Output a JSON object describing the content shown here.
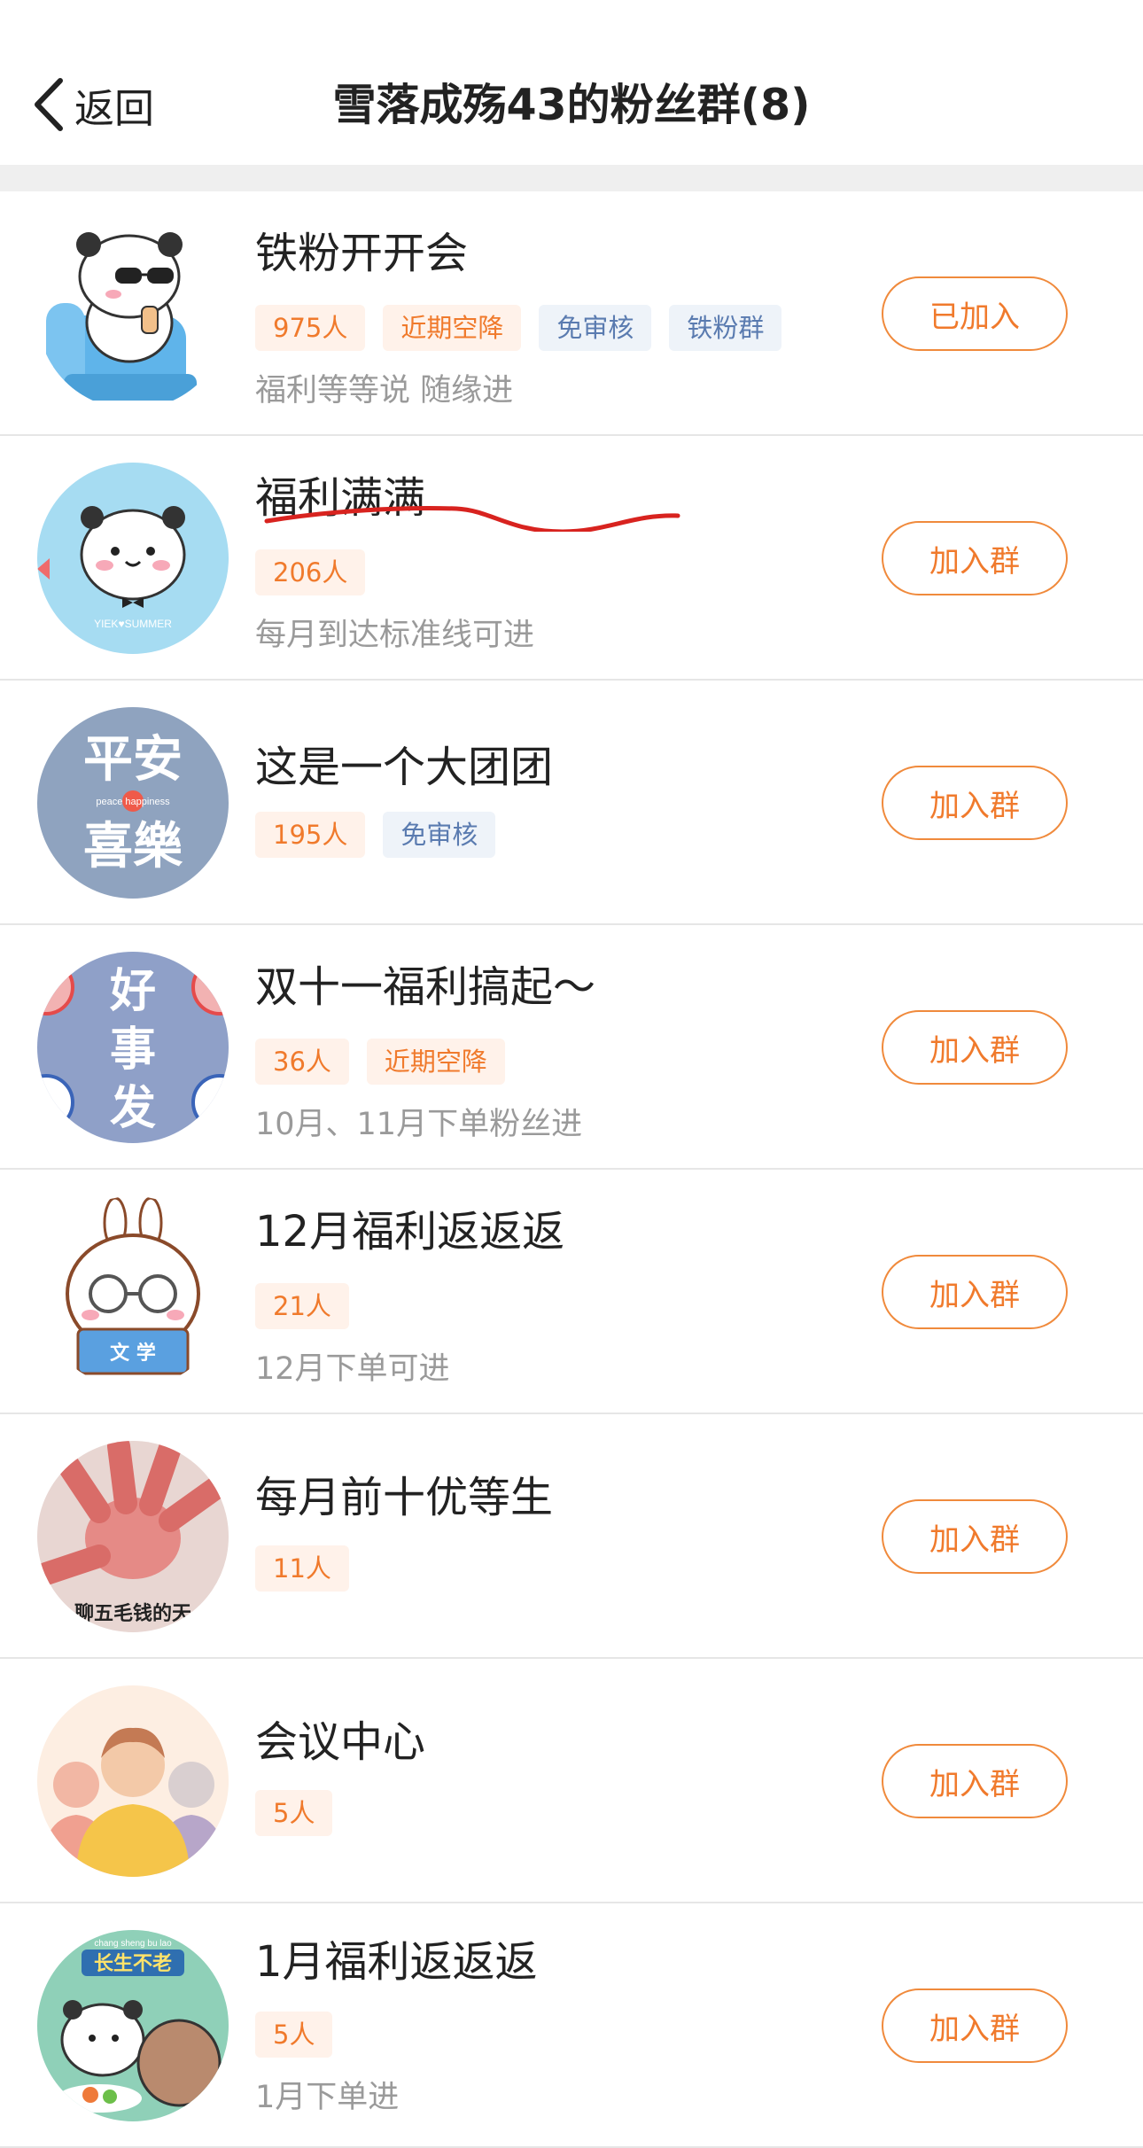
{
  "nav": {
    "back_label": "返回",
    "title": "雪落成殇43的粉丝群(8)"
  },
  "groups": [
    {
      "name": "铁粉开开会",
      "tags": [
        "975人",
        "近期空降",
        "免审核",
        "铁粉群"
      ],
      "desc": "福利等等说 随缘进",
      "button": "已加入"
    },
    {
      "name": "福利满满",
      "tags": [
        "206人"
      ],
      "desc": "每月到达标准线可进",
      "button": "加入群"
    },
    {
      "name": "这是一个大团团",
      "tags": [
        "195人",
        "免审核"
      ],
      "desc": "",
      "button": "加入群"
    },
    {
      "name": "双十一福利搞起～",
      "tags": [
        "36人",
        "近期空降"
      ],
      "desc": "10月、11月下单粉丝进",
      "button": "加入群"
    },
    {
      "name": "12月福利返返返",
      "tags": [
        "21人"
      ],
      "desc": "12月下单可进",
      "button": "加入群"
    },
    {
      "name": "每月前十优等生",
      "tags": [
        "11人"
      ],
      "desc": "",
      "button": "加入群"
    },
    {
      "name": "会议中心",
      "tags": [
        "5人"
      ],
      "desc": "",
      "button": "加入群"
    },
    {
      "name": "1月福利返返返",
      "tags": [
        "5人"
      ],
      "desc": "1月下单进",
      "button": "加入群"
    }
  ],
  "avatar_text": {
    "a2": "YIEK♥SUMMER",
    "a3_line1": "平安",
    "a3_mid": "peace happiness",
    "a3_line2": "喜樂",
    "a4": [
      "好",
      "事",
      "发"
    ],
    "a5": "文 学",
    "a6": "聊五毛钱的天",
    "a8_top": "chang sheng bu lao",
    "a8_title": "长生不老"
  },
  "colors": {
    "accent": "#f07a2c",
    "tag_orange_bg": "#fff2ea",
    "tag_blue_bg": "#eef3f9",
    "tag_blue_text": "#5a7bb0",
    "scribble": "#d8231f"
  }
}
